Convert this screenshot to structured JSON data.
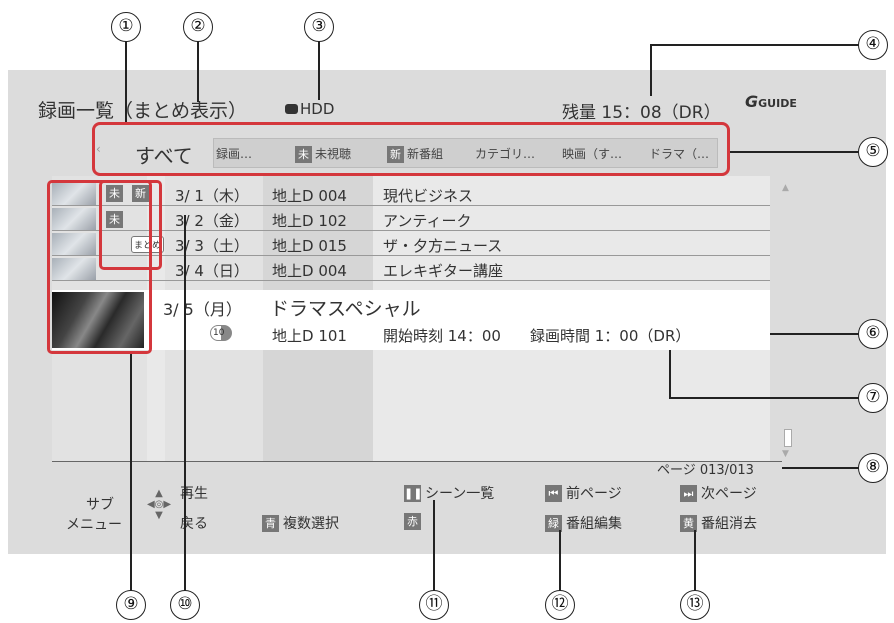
{
  "header": {
    "title": "録画一覧（まとめ表示）",
    "storage": "HDD",
    "remain": "残量 15：08（DR）",
    "guide_logo": "GUIDE"
  },
  "tabs": {
    "all": "すべて",
    "items": [
      "録画…",
      "未視聴",
      "新番組",
      "カテゴリ…",
      "映画（す…",
      "ドラマ（…"
    ],
    "unwatched_tag": "未",
    "new_tag": "新"
  },
  "list": {
    "rows": [
      {
        "tags": [
          "未",
          "新"
        ],
        "date": "3/ 1（木）",
        "channel": "地上D 004",
        "title": "現代ビジネス"
      },
      {
        "tags": [
          "未"
        ],
        "date": "3/ 2（金）",
        "channel": "地上D 102",
        "title": "アンティーク"
      },
      {
        "tags": [
          "まとめ"
        ],
        "date": "3/ 3（土）",
        "channel": "地上D 015",
        "title": "ザ・夕方ニュース"
      },
      {
        "tags": [],
        "date": "3/ 4（日）",
        "channel": "地上D 004",
        "title": "エレキギター講座"
      }
    ],
    "selected": {
      "date": "3/ 5（月）",
      "title": "ドラマスペシャル",
      "count_badge": "10",
      "channel": "地上D 101",
      "start": "開始時刻 14：00",
      "duration": "録画時間 1：00（DR）"
    },
    "page": "ページ 013/013"
  },
  "footer": {
    "sub_menu_line1": "サブ",
    "sub_menu_line2": "メニュー",
    "play": "再生",
    "back": "戻る",
    "scene_list": "シーン一覧",
    "prev_page": "前ページ",
    "next_page": "次ページ",
    "blue_key": "青",
    "multi_select": "複数選択",
    "red_key": "赤",
    "green_key": "緑",
    "edit_program": "番組編集",
    "yellow_key": "黄",
    "delete_program": "番組消去"
  },
  "callouts": [
    "①",
    "②",
    "③",
    "④",
    "⑤",
    "⑥",
    "⑦",
    "⑧",
    "⑨",
    "⑩",
    "⑪",
    "⑫",
    "⑬"
  ]
}
